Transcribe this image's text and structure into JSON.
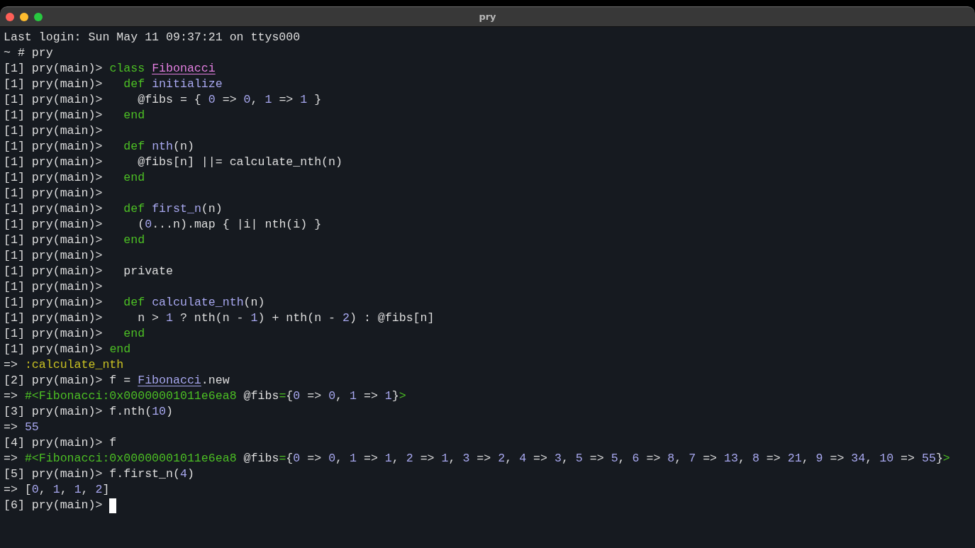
{
  "window": {
    "title": "pry"
  },
  "terminal": {
    "lines": [
      {
        "segments": [
          {
            "kind": "text",
            "text": "Last login: Sun May 11 09:37:21 on ttys000"
          }
        ]
      },
      {
        "segments": [
          {
            "kind": "text",
            "text": "~ # pry"
          }
        ]
      },
      {
        "segments": [
          {
            "kind": "text",
            "text": "[1] pry(main)> "
          },
          {
            "kind": "keyword",
            "text": "class "
          },
          {
            "kind": "constant",
            "text": "Fibonacci"
          }
        ]
      },
      {
        "segments": [
          {
            "kind": "text",
            "text": "[1] pry(main)>   "
          },
          {
            "kind": "keyword",
            "text": "def "
          },
          {
            "kind": "method",
            "text": "initialize"
          }
        ]
      },
      {
        "segments": [
          {
            "kind": "text",
            "text": "[1] pry(main)>     @fibs = { "
          },
          {
            "kind": "number",
            "text": "0"
          },
          {
            "kind": "text",
            "text": " => "
          },
          {
            "kind": "number",
            "text": "0"
          },
          {
            "kind": "text",
            "text": ", "
          },
          {
            "kind": "number",
            "text": "1"
          },
          {
            "kind": "text",
            "text": " => "
          },
          {
            "kind": "number",
            "text": "1"
          },
          {
            "kind": "text",
            "text": " }"
          }
        ]
      },
      {
        "segments": [
          {
            "kind": "text",
            "text": "[1] pry(main)>   "
          },
          {
            "kind": "keyword",
            "text": "end"
          }
        ]
      },
      {
        "segments": [
          {
            "kind": "text",
            "text": "[1] pry(main)>"
          }
        ]
      },
      {
        "segments": [
          {
            "kind": "text",
            "text": "[1] pry(main)>   "
          },
          {
            "kind": "keyword",
            "text": "def "
          },
          {
            "kind": "method",
            "text": "nth"
          },
          {
            "kind": "text",
            "text": "(n)"
          }
        ]
      },
      {
        "segments": [
          {
            "kind": "text",
            "text": "[1] pry(main)>     @fibs[n] ||= calculate_nth(n)"
          }
        ]
      },
      {
        "segments": [
          {
            "kind": "text",
            "text": "[1] pry(main)>   "
          },
          {
            "kind": "keyword",
            "text": "end"
          }
        ]
      },
      {
        "segments": [
          {
            "kind": "text",
            "text": "[1] pry(main)>"
          }
        ]
      },
      {
        "segments": [
          {
            "kind": "text",
            "text": "[1] pry(main)>   "
          },
          {
            "kind": "keyword",
            "text": "def "
          },
          {
            "kind": "method",
            "text": "first_n"
          },
          {
            "kind": "text",
            "text": "(n)"
          }
        ]
      },
      {
        "segments": [
          {
            "kind": "text",
            "text": "[1] pry(main)>     ("
          },
          {
            "kind": "number",
            "text": "0"
          },
          {
            "kind": "text",
            "text": "...n).map { |i| nth(i) }"
          }
        ]
      },
      {
        "segments": [
          {
            "kind": "text",
            "text": "[1] pry(main)>   "
          },
          {
            "kind": "keyword",
            "text": "end"
          }
        ]
      },
      {
        "segments": [
          {
            "kind": "text",
            "text": "[1] pry(main)>"
          }
        ]
      },
      {
        "segments": [
          {
            "kind": "text",
            "text": "[1] pry(main)>   private"
          }
        ]
      },
      {
        "segments": [
          {
            "kind": "text",
            "text": "[1] pry(main)>"
          }
        ]
      },
      {
        "segments": [
          {
            "kind": "text",
            "text": "[1] pry(main)>   "
          },
          {
            "kind": "keyword",
            "text": "def "
          },
          {
            "kind": "method",
            "text": "calculate_nth"
          },
          {
            "kind": "text",
            "text": "(n)"
          }
        ]
      },
      {
        "segments": [
          {
            "kind": "text",
            "text": "[1] pry(main)>     n > "
          },
          {
            "kind": "number",
            "text": "1"
          },
          {
            "kind": "text",
            "text": " ? nth(n - "
          },
          {
            "kind": "number",
            "text": "1"
          },
          {
            "kind": "text",
            "text": ") + nth(n - "
          },
          {
            "kind": "number",
            "text": "2"
          },
          {
            "kind": "text",
            "text": ") : @fibs[n]"
          }
        ]
      },
      {
        "segments": [
          {
            "kind": "text",
            "text": "[1] pry(main)>   "
          },
          {
            "kind": "keyword",
            "text": "end"
          }
        ]
      },
      {
        "segments": [
          {
            "kind": "text",
            "text": "[1] pry(main)> "
          },
          {
            "kind": "keyword",
            "text": "end"
          }
        ]
      },
      {
        "segments": [
          {
            "kind": "text",
            "text": "=> "
          },
          {
            "kind": "symbol",
            "text": ":calculate_nth"
          }
        ]
      },
      {
        "segments": [
          {
            "kind": "text",
            "text": "[2] pry(main)> f = "
          },
          {
            "kind": "classref",
            "text": "Fibonacci"
          },
          {
            "kind": "text",
            "text": ".new"
          }
        ]
      },
      {
        "segments": [
          {
            "kind": "text",
            "text": "=> "
          },
          {
            "kind": "object",
            "text": "#<Fibonacci:0x00000001011e6ea8"
          },
          {
            "kind": "text",
            "text": " @fibs"
          },
          {
            "kind": "object",
            "text": "="
          },
          {
            "kind": "text",
            "text": "{"
          },
          {
            "kind": "number",
            "text": "0"
          },
          {
            "kind": "text",
            "text": " => "
          },
          {
            "kind": "number",
            "text": "0"
          },
          {
            "kind": "text",
            "text": ", "
          },
          {
            "kind": "number",
            "text": "1"
          },
          {
            "kind": "text",
            "text": " => "
          },
          {
            "kind": "number",
            "text": "1"
          },
          {
            "kind": "text",
            "text": "}"
          },
          {
            "kind": "object",
            "text": ">"
          }
        ]
      },
      {
        "segments": [
          {
            "kind": "text",
            "text": "[3] pry(main)> f.nth("
          },
          {
            "kind": "number",
            "text": "10"
          },
          {
            "kind": "text",
            "text": ")"
          }
        ]
      },
      {
        "segments": [
          {
            "kind": "text",
            "text": "=> "
          },
          {
            "kind": "number",
            "text": "55"
          }
        ]
      },
      {
        "segments": [
          {
            "kind": "text",
            "text": "[4] pry(main)> f"
          }
        ]
      },
      {
        "segments": [
          {
            "kind": "text",
            "text": "=> "
          },
          {
            "kind": "object",
            "text": "#<Fibonacci:0x00000001011e6ea8"
          },
          {
            "kind": "text",
            "text": " @fibs"
          },
          {
            "kind": "object",
            "text": "="
          },
          {
            "kind": "text",
            "text": "{"
          },
          {
            "kind": "number",
            "text": "0"
          },
          {
            "kind": "text",
            "text": " => "
          },
          {
            "kind": "number",
            "text": "0"
          },
          {
            "kind": "text",
            "text": ", "
          },
          {
            "kind": "number",
            "text": "1"
          },
          {
            "kind": "text",
            "text": " => "
          },
          {
            "kind": "number",
            "text": "1"
          },
          {
            "kind": "text",
            "text": ", "
          },
          {
            "kind": "number",
            "text": "2"
          },
          {
            "kind": "text",
            "text": " => "
          },
          {
            "kind": "number",
            "text": "1"
          },
          {
            "kind": "text",
            "text": ", "
          },
          {
            "kind": "number",
            "text": "3"
          },
          {
            "kind": "text",
            "text": " => "
          },
          {
            "kind": "number",
            "text": "2"
          },
          {
            "kind": "text",
            "text": ", "
          },
          {
            "kind": "number",
            "text": "4"
          },
          {
            "kind": "text",
            "text": " => "
          },
          {
            "kind": "number",
            "text": "3"
          },
          {
            "kind": "text",
            "text": ", "
          },
          {
            "kind": "number",
            "text": "5"
          },
          {
            "kind": "text",
            "text": " => "
          },
          {
            "kind": "number",
            "text": "5"
          },
          {
            "kind": "text",
            "text": ", "
          },
          {
            "kind": "number",
            "text": "6"
          },
          {
            "kind": "text",
            "text": " => "
          },
          {
            "kind": "number",
            "text": "8"
          },
          {
            "kind": "text",
            "text": ", "
          },
          {
            "kind": "number",
            "text": "7"
          },
          {
            "kind": "text",
            "text": " => "
          },
          {
            "kind": "number",
            "text": "13"
          },
          {
            "kind": "text",
            "text": ", "
          },
          {
            "kind": "number",
            "text": "8"
          },
          {
            "kind": "text",
            "text": " => "
          },
          {
            "kind": "number",
            "text": "21"
          },
          {
            "kind": "text",
            "text": ", "
          },
          {
            "kind": "number",
            "text": "9"
          },
          {
            "kind": "text",
            "text": " => "
          },
          {
            "kind": "number",
            "text": "34"
          },
          {
            "kind": "text",
            "text": ", "
          },
          {
            "kind": "number",
            "text": "10"
          },
          {
            "kind": "text",
            "text": " => "
          },
          {
            "kind": "number",
            "text": "55"
          },
          {
            "kind": "text",
            "text": "}"
          },
          {
            "kind": "object",
            "text": ">"
          }
        ]
      },
      {
        "segments": [
          {
            "kind": "text",
            "text": "[5] pry(main)> f.first_n("
          },
          {
            "kind": "number",
            "text": "4"
          },
          {
            "kind": "text",
            "text": ")"
          }
        ]
      },
      {
        "segments": [
          {
            "kind": "text",
            "text": "=> ["
          },
          {
            "kind": "number",
            "text": "0"
          },
          {
            "kind": "text",
            "text": ", "
          },
          {
            "kind": "number",
            "text": "1"
          },
          {
            "kind": "text",
            "text": ", "
          },
          {
            "kind": "number",
            "text": "1"
          },
          {
            "kind": "text",
            "text": ", "
          },
          {
            "kind": "number",
            "text": "2"
          },
          {
            "kind": "text",
            "text": "]"
          }
        ]
      },
      {
        "segments": [
          {
            "kind": "text",
            "text": "[6] pry(main)> "
          }
        ],
        "cursor": true
      }
    ]
  }
}
